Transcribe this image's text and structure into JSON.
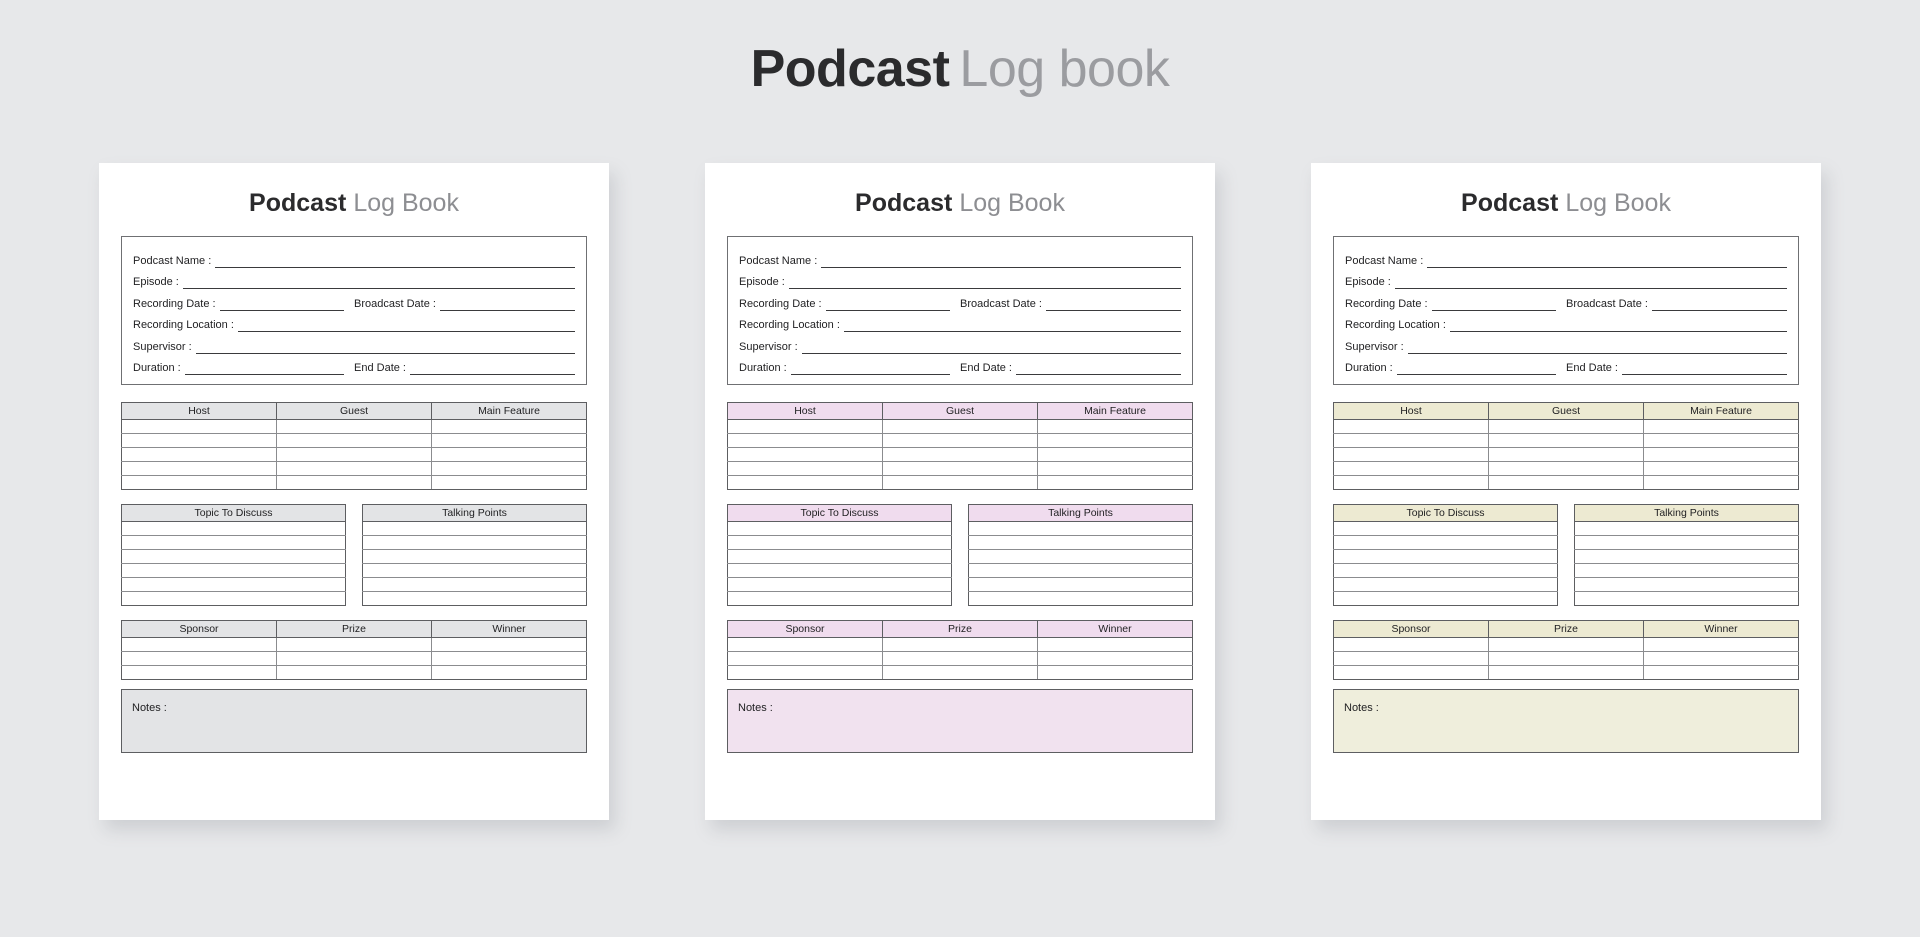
{
  "page": {
    "title_bold": "Podcast",
    "title_light": "Log book",
    "background_color": "#e7e8ea"
  },
  "card": {
    "title_bold": "Podcast",
    "title_light": "Log Book",
    "fields": {
      "podcast_name": "Podcast Name :",
      "episode": "Episode :",
      "recording_date": "Recording Date :",
      "broadcast_date": "Broadcast Date :",
      "recording_location": "Recording Location :",
      "supervisor": "Supervisor :",
      "duration": "Duration :",
      "end_date": "End Date :"
    },
    "guest_table": {
      "headers": [
        "Host",
        "Guest",
        "Main Feature"
      ],
      "row_count": 5
    },
    "topic_table": {
      "header": "Topic To Discuss",
      "row_count": 6
    },
    "talking_table": {
      "header": "Talking Points",
      "row_count": 6
    },
    "sponsor_table": {
      "headers": [
        "Sponsor",
        "Prize",
        "Winner"
      ],
      "row_count": 3
    },
    "notes_label": "Notes :"
  },
  "variants": [
    {
      "id": "gray",
      "header_color": "#e3e4e6",
      "notes_color": "#e3e4e6"
    },
    {
      "id": "pink",
      "header_color": "#f0dcee",
      "notes_color": "#f1e2ef"
    },
    {
      "id": "cream",
      "header_color": "#edead2",
      "notes_color": "#efeedc"
    }
  ]
}
